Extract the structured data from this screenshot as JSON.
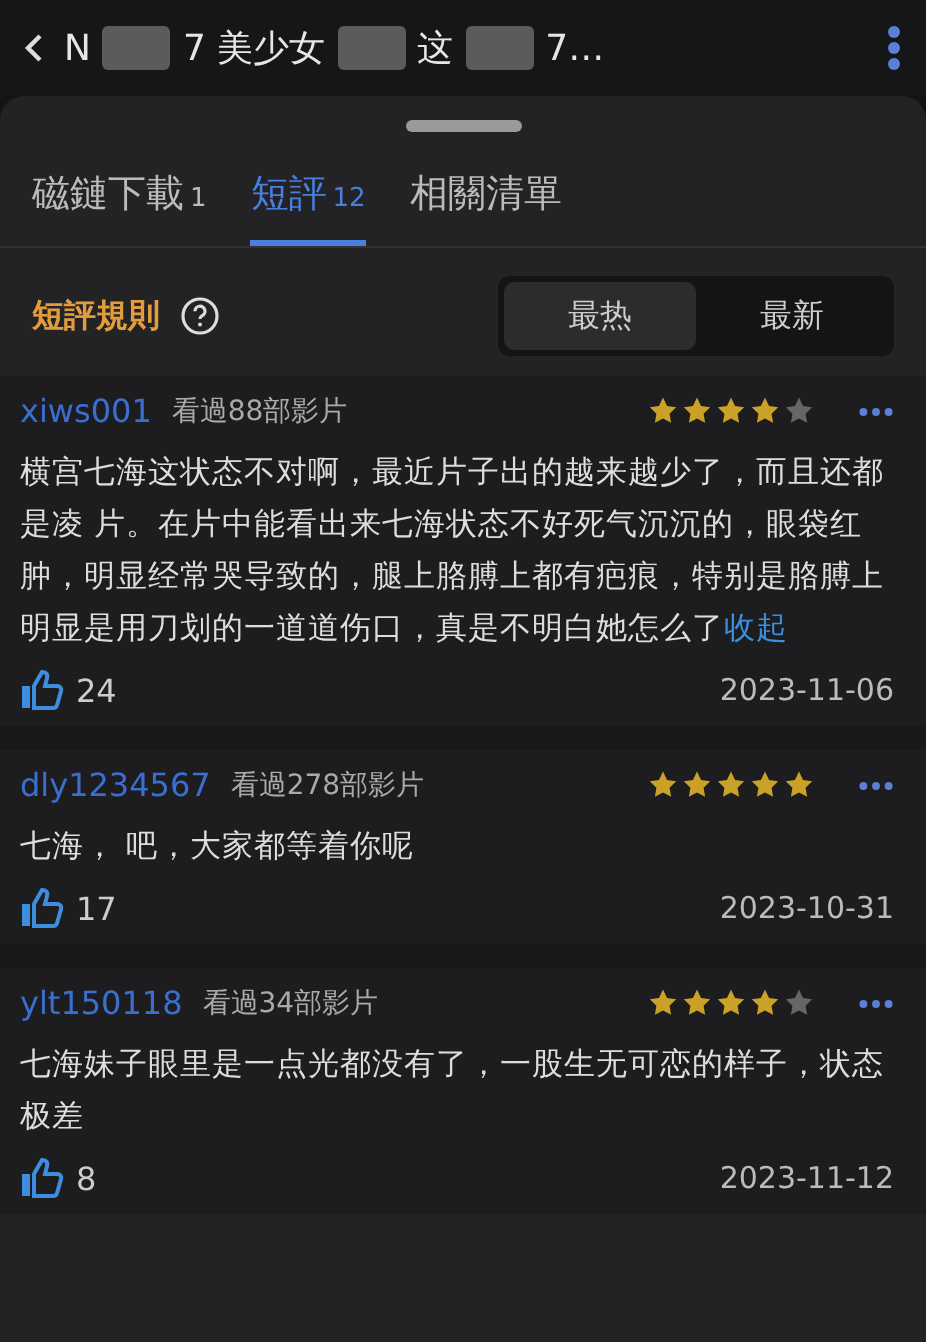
{
  "title_fragments": [
    "N",
    "7 美少女",
    "这",
    "7…"
  ],
  "tabs": [
    {
      "label": "磁鏈下載",
      "count": "1",
      "selected": false
    },
    {
      "label": "短評",
      "count": "12",
      "selected": true
    },
    {
      "label": "相關清單",
      "selected": false
    }
  ],
  "rules_label": "短評規則",
  "sort_options": [
    {
      "label": "最热",
      "selected": true
    },
    {
      "label": "最新",
      "selected": false
    }
  ],
  "comments": [
    {
      "user": "xiws001",
      "watched": "看過88部影片",
      "stars": 4,
      "text": "横宫七海这状态不对啊，最近片子出的越来越少了，而且还都是凌 片。在片中能看出来七海状态不好死气沉沉的，眼袋红肿，明显经常哭导致的，腿上胳膊上都有疤痕，特别是胳膊上明显是用刀划的一道道伤口，真是不明白她怎么了",
      "link": "收起",
      "likes": "24",
      "date": "2023-11-06"
    },
    {
      "user": "dly1234567",
      "watched": "看過278部影片",
      "stars": 5,
      "text": "七海， 吧，大家都等着你呢",
      "likes": "17",
      "date": "2023-10-31"
    },
    {
      "user": "ylt150118",
      "watched": "看過34部影片",
      "stars": 4,
      "text": "七海妹子眼里是一点光都没有了，一股生无可恋的样子，状态极差",
      "likes": "8",
      "date": "2023-11-12"
    }
  ]
}
